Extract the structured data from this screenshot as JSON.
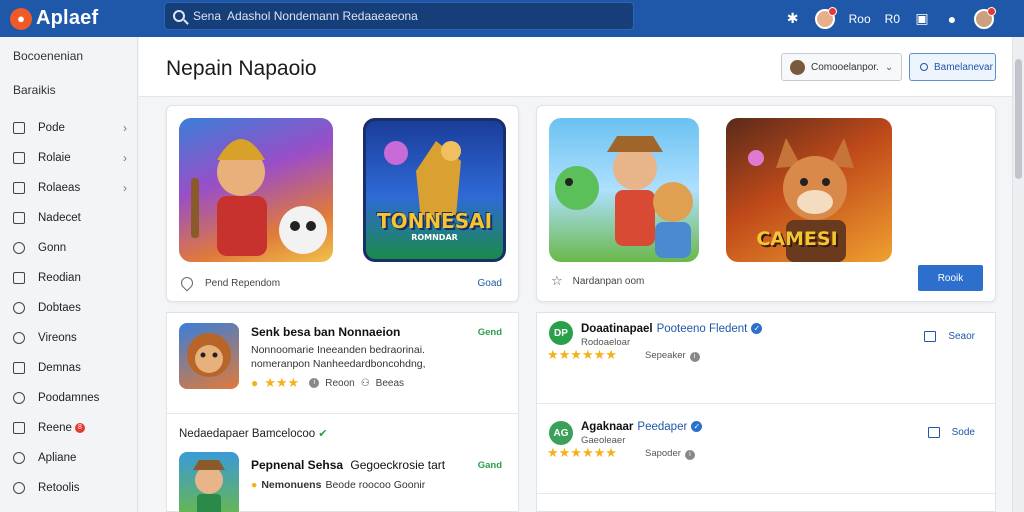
{
  "app": {
    "name": "Aplaef",
    "brand_color": "#1f58a8",
    "accent_color": "#f05a28"
  },
  "search": {
    "placeholder": "Sena  Adashol Nondemann Redaaeaeona",
    "icon": "search-icon"
  },
  "topbar": {
    "items": [
      {
        "icon": "bell-icon",
        "label": ""
      },
      {
        "icon": "avatar-icon",
        "label": "Roo"
      },
      {
        "icon": "",
        "label": "R0"
      },
      {
        "icon": "book-icon",
        "label": ""
      },
      {
        "icon": "user-icon",
        "label": ""
      }
    ]
  },
  "sidebar": {
    "headings": [
      "Bocoenenian",
      "Baraikis"
    ],
    "items": [
      {
        "label": "Pode",
        "icon": "square-icon",
        "chevron": true
      },
      {
        "label": "Rolaie",
        "icon": "square-icon",
        "chevron": true
      },
      {
        "label": "Rolaeas",
        "icon": "square-icon",
        "chevron": true
      },
      {
        "label": "Nadecet",
        "icon": "square-icon",
        "chevron": false
      },
      {
        "label": "Gonn",
        "icon": "chat-icon",
        "chevron": false
      },
      {
        "label": "Reodian",
        "icon": "doc-icon",
        "chevron": false
      },
      {
        "label": "Dobtaes",
        "icon": "circle-icon",
        "chevron": false
      },
      {
        "label": "Vireons",
        "icon": "circle-icon",
        "chevron": false
      },
      {
        "label": "Demnas",
        "icon": "square-icon",
        "chevron": false
      },
      {
        "label": "Poodamnes",
        "icon": "circle-icon",
        "chevron": false
      },
      {
        "label": "Reene",
        "icon": "square-icon",
        "chevron": false,
        "badge": "8"
      },
      {
        "label": "Apliane",
        "icon": "circle-icon",
        "chevron": false
      },
      {
        "label": "Retoolis",
        "icon": "circle-icon",
        "chevron": false
      }
    ]
  },
  "page": {
    "title": "Nepain Napaoio",
    "dropdown_label": "Comooelanpor.",
    "action_label": "Bamelanevar"
  },
  "featured": {
    "left": {
      "art1_label": "",
      "art2_label": "TONNESAI",
      "art2_sub": "ROMNDAR",
      "footer_text": "Pend  Rependom",
      "link": "Goad"
    },
    "right": {
      "art2_label": "CAMESI",
      "footer_text": "Nardanpan oom",
      "button": "Rooik"
    }
  },
  "apps_list": [
    {
      "title": "Senk besa ban Nonnaeion",
      "desc": "Nonnoomarie Ineeanden bedraorinai.\nnomeranpon Nanheedardboncohdng,",
      "tag": "Gend",
      "rating_label": "Reoon",
      "count_label": "Beeas"
    }
  ],
  "section": {
    "label": "Nedaedapaer Bamcelocoo"
  },
  "apps_list_2": [
    {
      "title": "Pepnenal Sehsa",
      "title_extra": "Gegoeckrosie tart",
      "desc_bold": "Nemonuens",
      "desc": "Beode roocoo Goonir",
      "tag": "Gand"
    }
  ],
  "developers": [
    {
      "name": "Doaatinapael",
      "sub": "Pooteeno Fledent",
      "small": "Rodoaeloar",
      "count": "Sepeaker",
      "action": "Seaor",
      "logo": "DP"
    },
    {
      "name": "Agaknaar",
      "sub": "Peedaper",
      "small": "Gaeoleaer",
      "count": "Sapoder",
      "action": "Sode",
      "logo": "AG"
    }
  ]
}
